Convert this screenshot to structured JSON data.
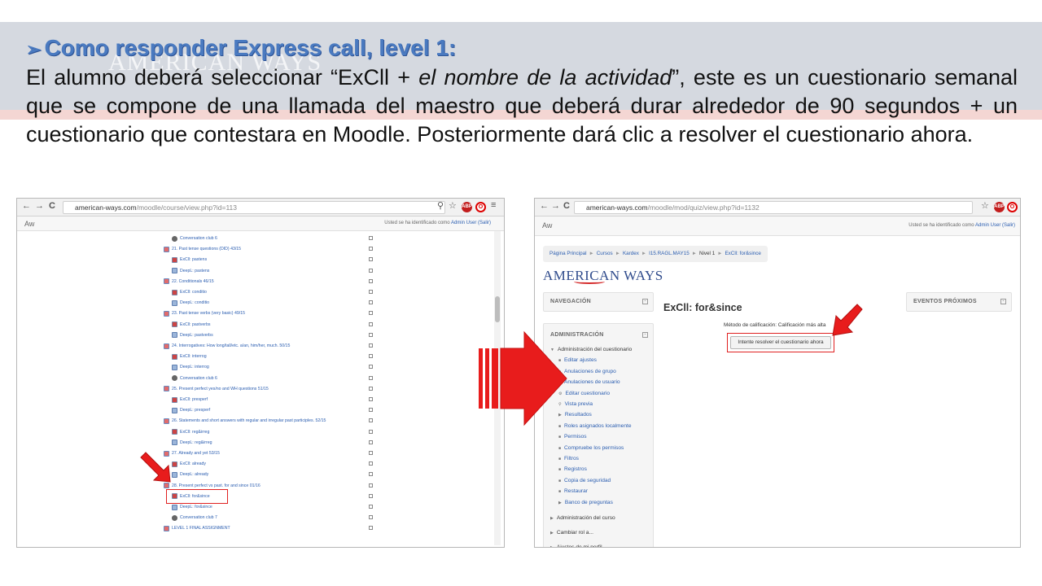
{
  "slide": {
    "watermark": "AMERICAN WAYS",
    "heading_bullet": "➢",
    "heading": "Como responder Express call, level 1:",
    "body": {
      "part1": "El alumno deberá seleccionar “ExCll + ",
      "italic": "el nombre de la actividad",
      "part2": "”, este es un cuestionario semanal que se compone de una llamada del maestro que deberá durar alrededor de 90 segundos + un cuestionario que contestara en Moodle. Posteriormente dará clic a resolver el cuestionario ahora."
    }
  },
  "left_browser": {
    "nav": {
      "back": "←",
      "forward": "→",
      "reload": "C"
    },
    "url_host": "american-ways.com",
    "url_path": "/moodle/course/view.php?id=113",
    "icons": {
      "search": "⚲",
      "star": "☆",
      "abp": "ABP",
      "opera": "O",
      "menu": "≡"
    },
    "site_short": "Aw",
    "login_text": "Usted se ha identificado como",
    "login_user": "Admin User (Salir)",
    "course_items": [
      {
        "type": "chat",
        "label": "Conversation club 6"
      },
      {
        "type": "folder",
        "label": "21. Past tense questions (DID) 43/15"
      },
      {
        "type": "quiz",
        "label": "ExCll: pastens"
      },
      {
        "type": "lesson",
        "label": "DeepL: pastens"
      },
      {
        "type": "folder",
        "label": "22. Conditionals 46/15"
      },
      {
        "type": "quiz",
        "label": "ExCll: conditio"
      },
      {
        "type": "lesson",
        "label": "DeepL: conditio"
      },
      {
        "type": "folder",
        "label": "23. Past tense verbs (very basic) 49/15"
      },
      {
        "type": "quiz",
        "label": "ExCll: pastverbs"
      },
      {
        "type": "lesson",
        "label": "DeepL: pastverbs"
      },
      {
        "type": "folder",
        "label": "24. Interrogatives: How long/tall/etc. a/an, him/her, much. 50/15"
      },
      {
        "type": "quiz",
        "label": "ExCll: interrog"
      },
      {
        "type": "lesson",
        "label": "DeepL: interrog"
      },
      {
        "type": "chat",
        "label": "Conversation club 6"
      },
      {
        "type": "folder",
        "label": "25. Present perfect yes/no and WH questions 51/15"
      },
      {
        "type": "quiz",
        "label": "ExCll: presperf"
      },
      {
        "type": "lesson",
        "label": "DeepL: presperf"
      },
      {
        "type": "folder",
        "label": "26. Statements and short answers with regular and irregular past participles. 52/15"
      },
      {
        "type": "quiz",
        "label": "ExCll: reg&irreg"
      },
      {
        "type": "lesson",
        "label": "DeepL: reg&irreg"
      },
      {
        "type": "folder",
        "label": "27. Already and yet 53/15"
      },
      {
        "type": "quiz",
        "label": "ExCll: already"
      },
      {
        "type": "lesson",
        "label": "DeepL: already"
      },
      {
        "type": "folder",
        "label": "28. Present perfect vs past. for and since 01/16"
      },
      {
        "type": "quiz",
        "label": "ExCll: for&since"
      },
      {
        "type": "lesson",
        "label": "DeepL: for&since"
      },
      {
        "type": "chat",
        "label": "Conversation club 7"
      },
      {
        "type": "folder",
        "label": "LEVEL 1 FINAL ASSIGNMENT"
      }
    ]
  },
  "right_browser": {
    "nav": {
      "back": "←",
      "forward": "→",
      "reload": "C"
    },
    "url_host": "american-ways.com",
    "url_path": "/moodle/mod/quiz/view.php?id=1132",
    "icons": {
      "star": "☆",
      "abp": "ABP",
      "opera": "O",
      "menu": "≡"
    },
    "site_short": "Aw",
    "login_text": "Usted se ha identificado como",
    "login_user": "Admin User (Salir)",
    "breadcrumb": [
      "Página Principal",
      "Cursos",
      "Kardex",
      "I15.RAGL.MAY15",
      "Nivel 1",
      "ExCll: for&since"
    ],
    "breadcrumb_sep": "►",
    "logo": "AMERICAN WAYS",
    "nav_block": "NAVEGACIÓN",
    "admin_block": "ADMINISTRACIÓN",
    "events_block": "EVENTOS PRÓXIMOS",
    "admin_menu": [
      {
        "label": "Administración del cuestionario",
        "mark": "▼",
        "dark": true
      },
      {
        "label": "Editar ajustes",
        "mark": "■"
      },
      {
        "label": "Anulaciones de grupo",
        "mark": "■"
      },
      {
        "label": "Anulaciones de usuario",
        "mark": "■"
      },
      {
        "label": "Editar cuestionario",
        "mark": "⚙"
      },
      {
        "label": "Vista previa",
        "mark": "⚲"
      },
      {
        "label": "Resultados",
        "mark": "▶"
      },
      {
        "label": "Roles asignados localmente",
        "mark": "■"
      },
      {
        "label": "Permisos",
        "mark": "■"
      },
      {
        "label": "Compruebe los permisos",
        "mark": "■"
      },
      {
        "label": "Filtros",
        "mark": "■"
      },
      {
        "label": "Registros",
        "mark": "■"
      },
      {
        "label": "Copia de seguridad",
        "mark": "■"
      },
      {
        "label": "Restaurar",
        "mark": "■"
      },
      {
        "label": "Banco de preguntas",
        "mark": "▶"
      }
    ],
    "admin_footer": [
      {
        "label": "Administración del curso",
        "mark": "▶"
      },
      {
        "label": "Cambiar rol a...",
        "mark": "▶"
      },
      {
        "label": "Ajustes de mi perfil",
        "mark": "▶"
      }
    ],
    "quiz_title": "ExCll: for&since",
    "grading": "Método de calificación: Calificación más alta",
    "attempt_button": "Intente resolver el cuestionario ahora"
  },
  "colors": {
    "band": "#d5d9e0",
    "heading": "#4a7ac0",
    "highlight": "#e02020",
    "arrow": "#e81c1c",
    "link": "#2a5db0"
  }
}
